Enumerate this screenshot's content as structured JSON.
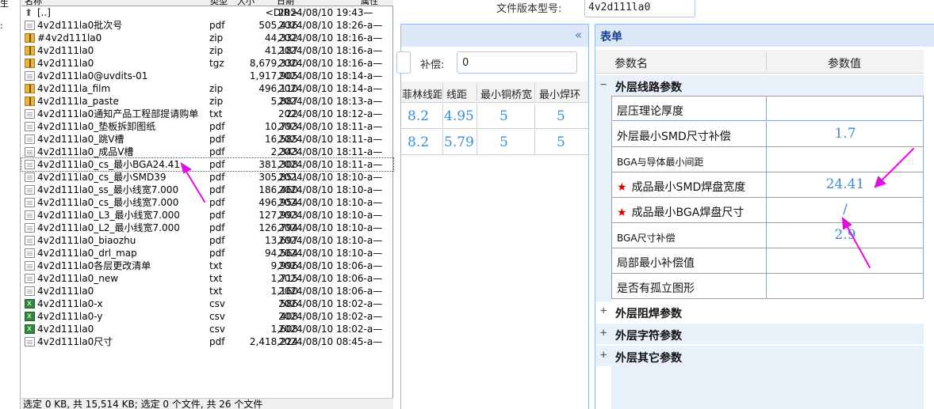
{
  "left_strip": {
    "labels": [
      "生",
      ":",
      "",
      "",
      "",
      ""
    ]
  },
  "file_manager": {
    "columns": {
      "name": "名称",
      "type": "类型",
      "size": "大小",
      "date": "日期",
      "attr": "属性"
    },
    "files": [
      {
        "icon": "up-folder-icon",
        "name": "[..]",
        "type": "",
        "size": "<DIR>",
        "date": "2024/08/10 19:43—"
      },
      {
        "icon": "document-icon",
        "name": "4v2d111la0批次号",
        "type": "pdf",
        "size": "505,436",
        "date": "2024/08/10 18:26-a—"
      },
      {
        "icon": "zip-icon",
        "name": "#4v2d111la0",
        "type": "zip",
        "size": "44,332",
        "date": "2024/08/10 18:16-a—"
      },
      {
        "icon": "zip-icon",
        "name": "4v2d111la0",
        "type": "zip",
        "size": "41,187",
        "date": "2024/08/10 18:16-a—"
      },
      {
        "icon": "zip-icon",
        "name": "4v2d111la0",
        "type": "tgz",
        "size": "8,679,330",
        "date": "2024/08/10 18:16-a—"
      },
      {
        "icon": "document-icon",
        "name": "4v2d111la0@uvdits-01",
        "type": "",
        "size": "1,917,905",
        "date": "2024/08/10 18:14-a—"
      },
      {
        "icon": "zip-icon",
        "name": "4v2d111la_film",
        "type": "zip",
        "size": "496,110",
        "date": "2024/08/10 18:14-a—"
      },
      {
        "icon": "zip-icon",
        "name": "4v2d111la_paste",
        "type": "zip",
        "size": "5,887",
        "date": "2024/08/10 18:13-a—"
      },
      {
        "icon": "document-icon",
        "name": "4v2d111la0通知产品工程部提请购单",
        "type": "txt",
        "size": "22",
        "date": "2024/08/10 18:12-a—"
      },
      {
        "icon": "document-icon",
        "name": "4v2d111la0_垫板拆卸图纸",
        "type": "pdf",
        "size": "10,793",
        "date": "2024/08/10 18:11-a—"
      },
      {
        "icon": "document-icon",
        "name": "4v2d111la0_跳V槽",
        "type": "pdf",
        "size": "16,585",
        "date": "2024/08/10 18:11-a—"
      },
      {
        "icon": "document-icon",
        "name": "4v2d111la0_成品V槽",
        "type": "pdf",
        "size": "2,343",
        "date": "2024/08/10 18:11-a—"
      },
      {
        "icon": "document-icon",
        "name": "4v2d111la0_cs_最小BGA24.41",
        "type": "pdf",
        "size": "381,308",
        "date": "2024/08/10 18:11-a—",
        "selected": true
      },
      {
        "icon": "document-icon",
        "name": "4v2d111la0_cs_最小SMD39",
        "type": "pdf",
        "size": "305,851",
        "date": "2024/08/10 18:10-a—"
      },
      {
        "icon": "document-icon",
        "name": "4v2d111la0_ss_最小线宽7.000",
        "type": "pdf",
        "size": "186,460",
        "date": "2024/08/10 18:10-a—"
      },
      {
        "icon": "document-icon",
        "name": "4v2d111la0_cs_最小线宽7.000",
        "type": "pdf",
        "size": "496,954",
        "date": "2024/08/10 18:10-a—"
      },
      {
        "icon": "document-icon",
        "name": "4v2d111la0_L3_最小线宽7.000",
        "type": "pdf",
        "size": "127,993",
        "date": "2024/08/10 18:10-a—"
      },
      {
        "icon": "document-icon",
        "name": "4v2d111la0_L2_最小线宽7.000",
        "type": "pdf",
        "size": "126,794",
        "date": "2024/08/10 18:10-a—"
      },
      {
        "icon": "document-icon",
        "name": "4v2d111la0_biaozhu",
        "type": "pdf",
        "size": "13,697",
        "date": "2024/08/10 18:10-a—"
      },
      {
        "icon": "document-icon",
        "name": "4v2d111la0_drl_map",
        "type": "pdf",
        "size": "94,564",
        "date": "2024/08/10 18:10-a—"
      },
      {
        "icon": "document-icon",
        "name": "4v2d111la0各层更改清单",
        "type": "txt",
        "size": "9,996",
        "date": "2024/08/10 18:06-a—"
      },
      {
        "icon": "document-icon",
        "name": "4v2d111la0_new",
        "type": "txt",
        "size": "1,715",
        "date": "2024/08/10 18:06-a—"
      },
      {
        "icon": "document-icon",
        "name": "4v2d111la0",
        "type": "txt",
        "size": "1,160",
        "date": "2024/08/10 18:06-a—"
      },
      {
        "icon": "csv-icon",
        "name": "4v2d111la0-x",
        "type": "csv",
        "size": "586",
        "date": "2024/08/10 18:02-a—"
      },
      {
        "icon": "csv-icon",
        "name": "4v2d111la0-y",
        "type": "csv",
        "size": "408",
        "date": "2024/08/10 18:02-a—"
      },
      {
        "icon": "csv-icon",
        "name": "4v2d111la0",
        "type": "csv",
        "size": "1,608",
        "date": "2024/08/10 18:02-a—"
      },
      {
        "icon": "document-icon",
        "name": "4v2d111la0尺寸",
        "type": "pdf",
        "size": "2,418,224",
        "date": "2024/08/10 08:45-a—"
      }
    ],
    "status": "选定 0 KB, 共 15,514 KB; 选定 0 个文件, 共 26 个文件"
  },
  "version": {
    "label": "文件版本型号:",
    "value": "4v2d111la0"
  },
  "mid_panel": {
    "collapse_glyph": "«",
    "compensation_label": "补偿:",
    "compensation_value": "0",
    "columns": [
      "菲林线距",
      "线距",
      "最小铜桥宽",
      "最小焊环"
    ],
    "rows": [
      [
        "8.2",
        "4.95",
        "5",
        "5"
      ],
      [
        "8.2",
        "5.79",
        "5",
        "5"
      ]
    ]
  },
  "form": {
    "title": "表单",
    "col_name": "参数名",
    "col_value": "参数值",
    "groups": [
      {
        "toggle": "−",
        "title": "外层线路参数"
      },
      {
        "toggle": "+",
        "title": "外层阻焊参数"
      },
      {
        "toggle": "+",
        "title": "外层字符参数"
      },
      {
        "toggle": "+",
        "title": "外层其它参数"
      }
    ],
    "rows": [
      {
        "name": "层压理论厚度",
        "value": "",
        "required": false
      },
      {
        "name": "外层最小SMD尺寸补偿",
        "value": "1.7",
        "required": false
      },
      {
        "name": "BGA与导体最小间距",
        "value": "",
        "required": false
      },
      {
        "name": "成品最小SMD焊盘宽度",
        "value": "24.41",
        "required": true
      },
      {
        "name": "成品最小BGA焊盘尺寸",
        "value": "/",
        "required": true
      },
      {
        "name": "BGA尺寸补偿",
        "value": "2.9",
        "required": false
      },
      {
        "name": "局部最小补偿值",
        "value": "",
        "required": false
      },
      {
        "name": "是否有孤立图形",
        "value": "",
        "required": false
      }
    ]
  },
  "colors": {
    "annotation_arrow": "#e010e0",
    "value_text": "#3a8ed6",
    "required_star": "#e00000"
  }
}
